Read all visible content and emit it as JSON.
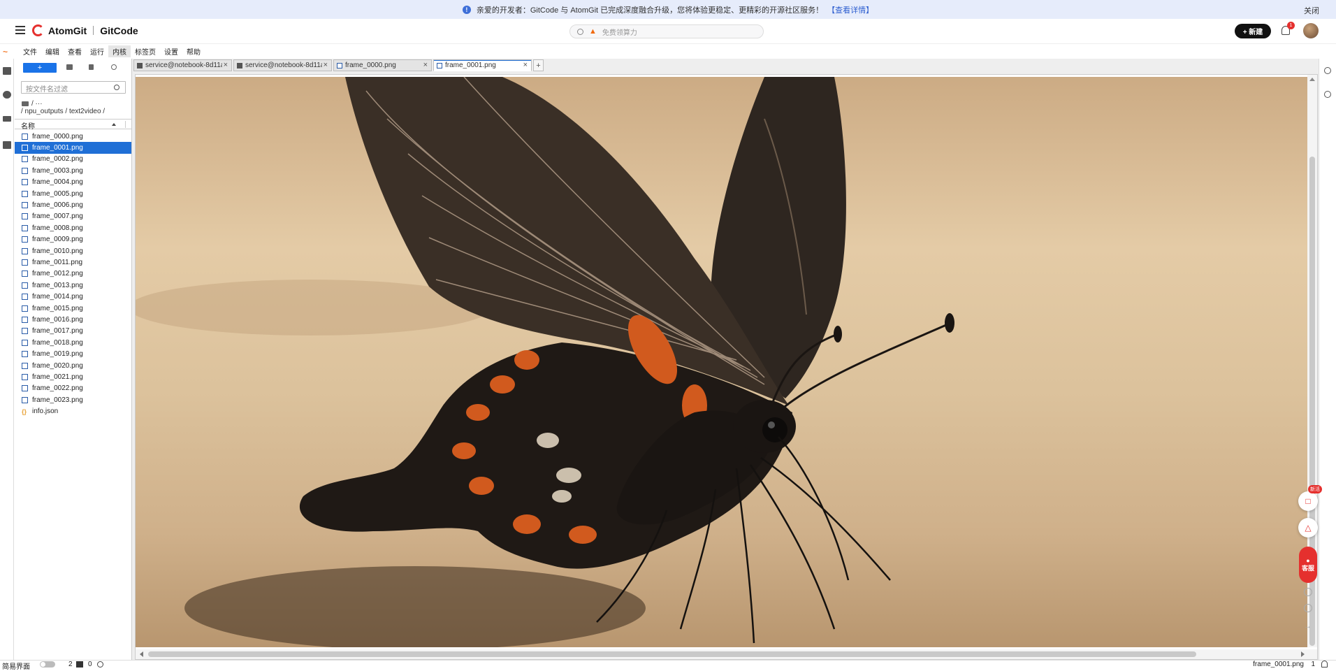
{
  "banner": {
    "info_icon": "info-icon",
    "message": "亲爱的开发者：GitCode 与 AtomGit 已完成深度融合升级，您将体验更稳定、更精彩的开源社区服务！",
    "link": "【查看详情】",
    "close": "关闭"
  },
  "header": {
    "brand_left": "AtomGit",
    "brand_right": "GitCode",
    "search_placeholder": "免费领算力",
    "new_button": "+ 新建",
    "notification_count": "1"
  },
  "menu": {
    "items": [
      "文件",
      "编辑",
      "查看",
      "运行",
      "内核",
      "标签页",
      "设置",
      "帮助"
    ],
    "active": "内核"
  },
  "file_browser": {
    "new_button": "+",
    "filter_placeholder": "按文件名过滤",
    "crumb_top": "/ ···",
    "crumb_path": "/ npu_outputs / text2video /",
    "column_name": "名称",
    "files": [
      "frame_0000.png",
      "frame_0001.png",
      "frame_0002.png",
      "frame_0003.png",
      "frame_0004.png",
      "frame_0005.png",
      "frame_0006.png",
      "frame_0007.png",
      "frame_0008.png",
      "frame_0009.png",
      "frame_0010.png",
      "frame_0011.png",
      "frame_0012.png",
      "frame_0013.png",
      "frame_0014.png",
      "frame_0015.png",
      "frame_0016.png",
      "frame_0017.png",
      "frame_0018.png",
      "frame_0019.png",
      "frame_0020.png",
      "frame_0021.png",
      "frame_0022.png",
      "frame_0023.png"
    ],
    "json_file": "info.json",
    "selected": "frame_0001.png"
  },
  "tabs": [
    {
      "label": "service@notebook-8d11a",
      "icon": "terminal-icon"
    },
    {
      "label": "service@notebook-8d11a",
      "icon": "terminal-icon"
    },
    {
      "label": "frame_0000.png",
      "icon": "image-icon"
    },
    {
      "label": "frame_0001.png",
      "icon": "image-icon",
      "active": true
    }
  ],
  "floating": {
    "new_badge": "新活",
    "kefu": "客服"
  },
  "status": {
    "simple_mode": "简易界面",
    "count_a": "2",
    "count_b": "0",
    "current_file": "frame_0001.png",
    "count_c": "1"
  },
  "colors": {
    "accent": "#1f6fd6",
    "brand_red": "#e5302e",
    "banner_bg": "#e6ecfb"
  }
}
